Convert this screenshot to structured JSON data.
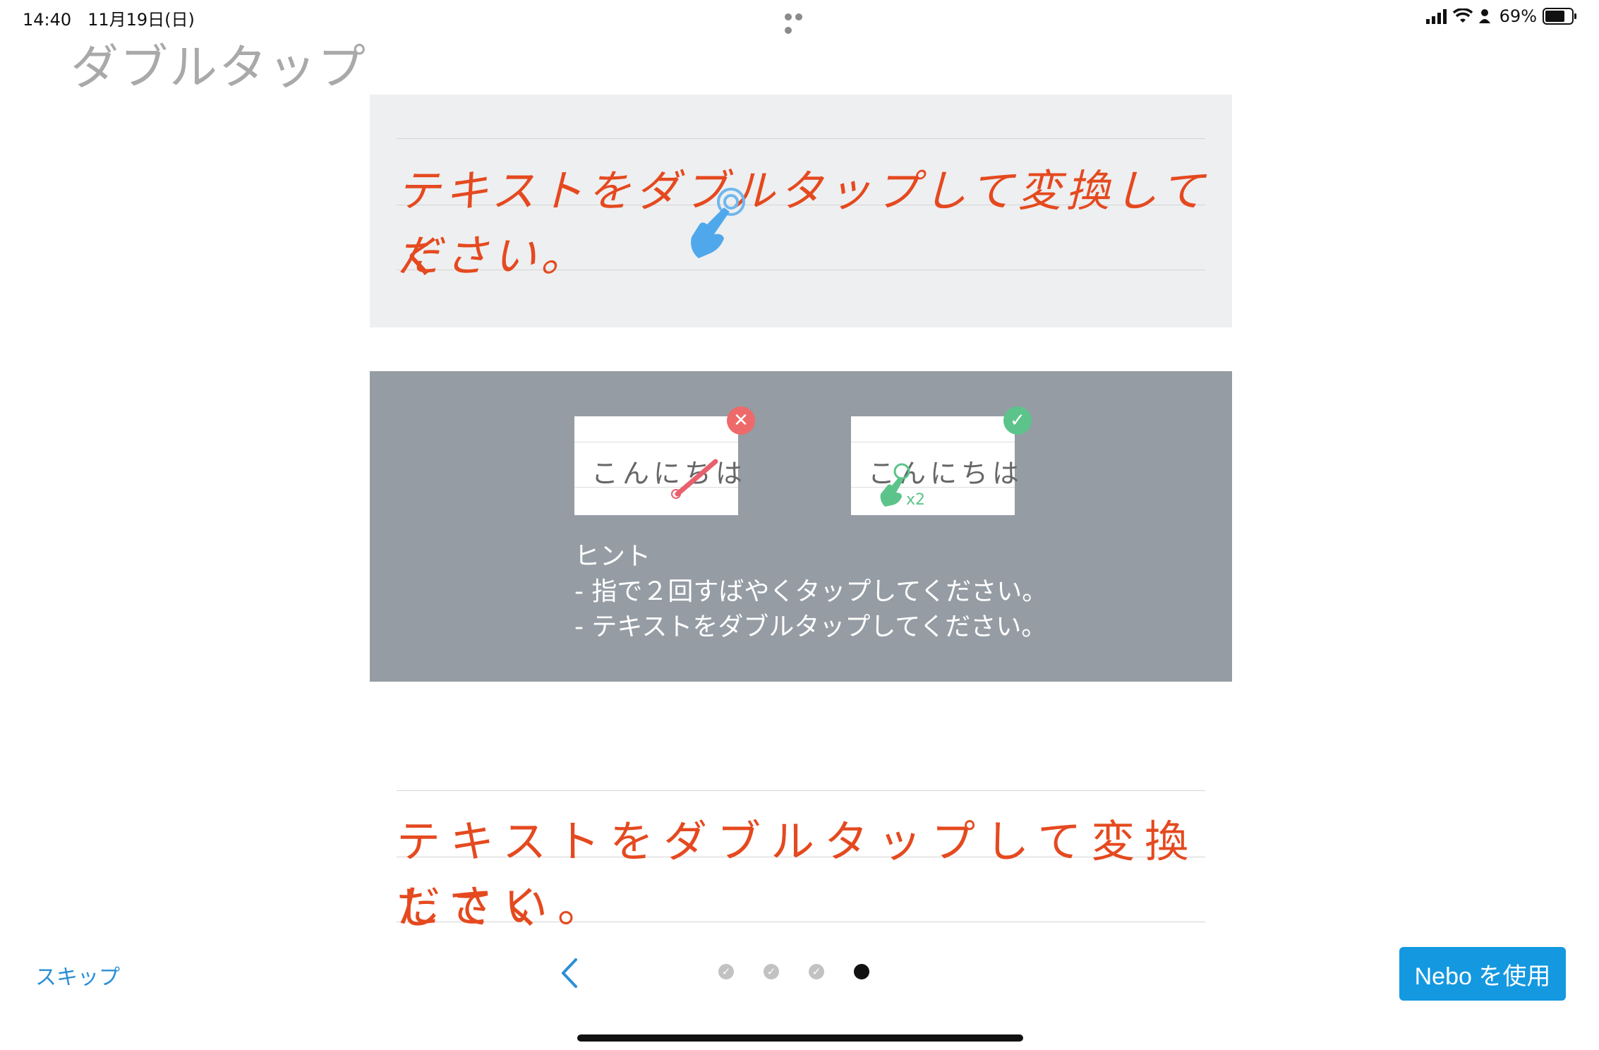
{
  "status_bar": {
    "time": "14:40",
    "date": "11月19日(日)",
    "battery": "69%",
    "icons": [
      "signal-icon",
      "wifi-icon",
      "person-icon",
      "battery-icon"
    ]
  },
  "page": {
    "title": "ダブルタップ"
  },
  "demo": {
    "line1": "テキストをダブルタップして変換してく",
    "line2": "ださい。"
  },
  "hint": {
    "example_wrong_text": "こんにちは",
    "example_right_text": "こんにちは",
    "example_right_caption": "x2",
    "heading": "ヒント",
    "tip1": "- 指で２回すばやくタップしてください。",
    "tip2": "- テキストをダブルタップしてください。"
  },
  "practice": {
    "line1": "テキストをダブルタップして変換してく",
    "line2": "ださい。"
  },
  "footer": {
    "skip_label": "スキップ",
    "use_button_label": "Nebo を使用",
    "pager": {
      "total": 4,
      "current": 4
    }
  },
  "colors": {
    "accent": "#1498e0",
    "handwriting": "#e5491f",
    "panel_gray": "#959ca4",
    "demo_bg": "#eeeff0",
    "error": "#ee6a6a",
    "success": "#5cc48b"
  }
}
